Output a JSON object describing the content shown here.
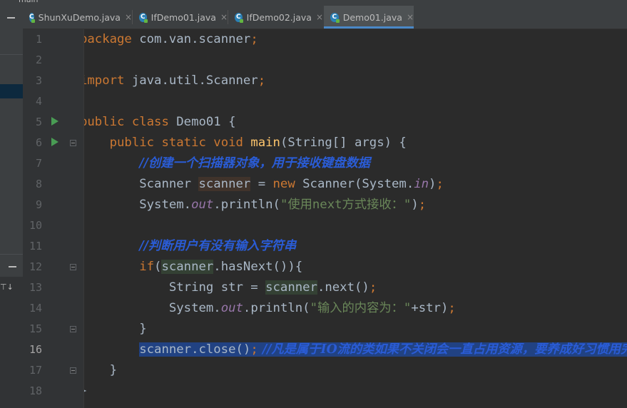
{
  "breadcrumb": "main",
  "tabs": [
    {
      "label": "ShunXuDemo.java",
      "icon": "java-class-icon",
      "active": false
    },
    {
      "label": "IfDemo01.java",
      "icon": "java-class-icon",
      "active": false
    },
    {
      "label": "IfDemo02.java",
      "icon": "java-class-icon",
      "active": false
    },
    {
      "label": "Demo01.java",
      "icon": "java-class-icon",
      "active": true
    }
  ],
  "tab_close_glyph": "×",
  "class_icon_glyph": "C",
  "line_numbers": [
    "1",
    "2",
    "3",
    "4",
    "5",
    "6",
    "7",
    "8",
    "9",
    "10",
    "11",
    "12",
    "13",
    "14",
    "15",
    "16",
    "17",
    "18"
  ],
  "current_line": "16",
  "code": {
    "l1_kw": "package",
    "l1_rest": " com.van.scanner",
    "l1_semi": ";",
    "l3_kw": "import",
    "l3_rest": " java.util.Scanner",
    "l3_semi": ";",
    "l5_kw": "public class",
    "l5_rest": " Demo01 {",
    "l6_kw": "public static void",
    "l6_fn": "main",
    "l6_rest": "(String[] args) {",
    "l7_cmt": "//创建一个扫描器对象，用于接收键盘数据",
    "l8_a": "Scanner ",
    "l8_var": "scanner",
    "l8_b": " = ",
    "l8_kw": "new",
    "l8_c": " Scanner(System.",
    "l8_fld": "in",
    "l8_d": ")",
    "l8_semi": ";",
    "l9_a": "System.",
    "l9_fld": "out",
    "l9_b": ".println(",
    "l9_str": "\"使用next方式接收：\"",
    "l9_c": ")",
    "l9_semi": ";",
    "l11_cmt": "//判断用户有没有输入字符串",
    "l12_kw": "if",
    "l12_a": "(",
    "l12_var": "scanner",
    "l12_b": ".hasNext()){",
    "l13_a": "String str = ",
    "l13_var": "scanner",
    "l13_b": ".next()",
    "l13_semi": ";",
    "l14_a": "System.",
    "l14_fld": "out",
    "l14_b": ".println(",
    "l14_str": "\"输入的内容为：\"",
    "l14_c": "+str)",
    "l14_semi": ";",
    "l15": "}",
    "l16_a": "scanner.close()",
    "l16_semi": ";",
    "l16_cmt": " //凡是属于IO流的类如果不关闭会一直占用资源，要养成好习惯用完就关掉",
    "l17": "}",
    "l18": "}"
  },
  "colors": {
    "background": "#2b2b2b",
    "keyword": "#cc7832",
    "method": "#ffc66d",
    "string": "#6a8759",
    "field": "#9876aa",
    "comment": "#2a5cd6",
    "selection": "#214283",
    "run_icon": "#499c54",
    "active_tab_underline": "#4a88c7"
  }
}
